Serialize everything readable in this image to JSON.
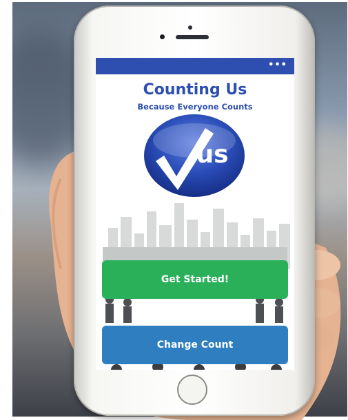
{
  "app": {
    "menu_label": "•••",
    "title": "Counting Us",
    "subtitle": "Because Everyone Counts",
    "logo_text": "us"
  },
  "actions": {
    "get_started_label": "Get Started!",
    "change_count_label": "Change Count"
  },
  "colors": {
    "header_blue": "#2f4fb0",
    "title_blue": "#2d4fb1",
    "get_started_green": "#2bb05a",
    "change_count_blue": "#2f7fc0"
  },
  "icons": {
    "menu": "more-dots-icon",
    "logo": "checkmark-logo-icon"
  }
}
